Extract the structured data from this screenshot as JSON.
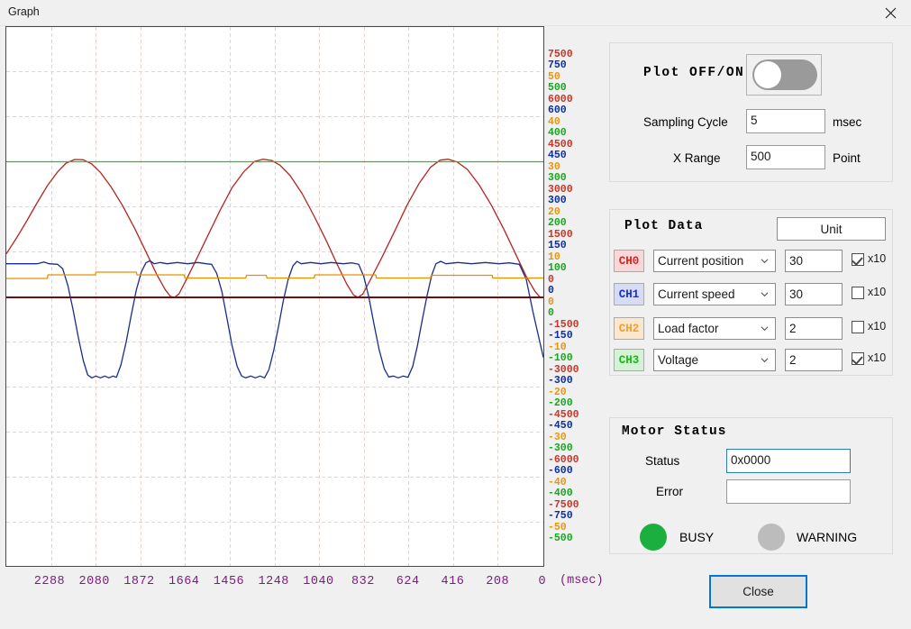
{
  "window": {
    "title": "Graph",
    "close_icon": "close-icon"
  },
  "chart_data": {
    "type": "line",
    "title": "",
    "xlabel": "(msec)",
    "ylabel": "",
    "grid": true,
    "legend_position": "none",
    "x_ticks": [
      2288,
      2080,
      1872,
      1664,
      1456,
      1248,
      1040,
      832,
      624,
      416,
      208,
      0
    ],
    "x_unit": "(msec)",
    "xlim": [
      2496,
      0
    ],
    "y_scales": [
      {
        "channel": "CH0",
        "name": "Current position",
        "color": "#c0392b",
        "ticks": [
          7500,
          6000,
          4500,
          3000,
          1500,
          0,
          -1500,
          -3000,
          -4500,
          -6000,
          -7500
        ]
      },
      {
        "channel": "CH1",
        "name": "Current speed",
        "color": "#0d2f9e",
        "ticks": [
          750,
          600,
          450,
          300,
          150,
          0,
          -150,
          -300,
          -450,
          -600,
          -750
        ]
      },
      {
        "channel": "CH2",
        "name": "Load factor",
        "color": "#e8960c",
        "ticks": [
          50,
          40,
          30,
          20,
          10,
          0,
          -10,
          -20,
          -30,
          -40,
          -50
        ]
      },
      {
        "channel": "CH3",
        "name": "Voltage",
        "color": "#16a81c",
        "ticks": [
          500,
          400,
          300,
          200,
          100,
          0,
          -100,
          -200,
          -300,
          -400,
          -500
        ]
      }
    ],
    "series": [
      {
        "name": "CH0 Current position",
        "color": "#b52521",
        "description": "Triangular/sine-like sweep, 3 cycles, peak ~4600, trough ~0",
        "points": [
          [
            0,
            1450
          ],
          [
            30,
            1980
          ],
          [
            60,
            2550
          ],
          [
            90,
            3150
          ],
          [
            120,
            3720
          ],
          [
            150,
            4180
          ],
          [
            175,
            4470
          ],
          [
            200,
            4590
          ],
          [
            225,
            4580
          ],
          [
            250,
            4440
          ],
          [
            275,
            4160
          ],
          [
            305,
            3700
          ],
          [
            340,
            3050
          ],
          [
            375,
            2300
          ],
          [
            410,
            1480
          ],
          [
            440,
            760
          ],
          [
            465,
            250
          ],
          [
            480,
            30
          ],
          [
            492,
            0
          ],
          [
            505,
            120
          ],
          [
            525,
            560
          ],
          [
            555,
            1250
          ],
          [
            590,
            2080
          ],
          [
            625,
            2900
          ],
          [
            660,
            3650
          ],
          [
            695,
            4190
          ],
          [
            725,
            4520
          ],
          [
            750,
            4600
          ],
          [
            775,
            4560
          ],
          [
            800,
            4400
          ],
          [
            830,
            4050
          ],
          [
            865,
            3450
          ],
          [
            900,
            2700
          ],
          [
            935,
            1900
          ],
          [
            968,
            1080
          ],
          [
            995,
            450
          ],
          [
            1015,
            80
          ],
          [
            1028,
            0
          ],
          [
            1042,
            110
          ],
          [
            1065,
            600
          ],
          [
            1098,
            1330
          ],
          [
            1135,
            2200
          ],
          [
            1172,
            3080
          ],
          [
            1208,
            3820
          ],
          [
            1240,
            4330
          ],
          [
            1268,
            4570
          ],
          [
            1292,
            4600
          ],
          [
            1318,
            4510
          ],
          [
            1348,
            4260
          ],
          [
            1382,
            3750
          ],
          [
            1418,
            3070
          ],
          [
            1455,
            2260
          ],
          [
            1490,
            1420
          ],
          [
            1520,
            700
          ],
          [
            1545,
            210
          ],
          [
            1560,
            10
          ],
          [
            1570,
            0
          ]
        ]
      },
      {
        "name": "CH1 Current speed",
        "color": "#1a2c8c",
        "description": "Trapezoidal speed profile alternating positive plateau ~110 and negative plateau ~-260",
        "points": [
          [
            0,
            112
          ],
          [
            90,
            112
          ],
          [
            110,
            118
          ],
          [
            125,
            112
          ],
          [
            150,
            110
          ],
          [
            165,
            95
          ],
          [
            180,
            40
          ],
          [
            195,
            -40
          ],
          [
            210,
            -130
          ],
          [
            225,
            -210
          ],
          [
            238,
            -258
          ],
          [
            250,
            -268
          ],
          [
            262,
            -262
          ],
          [
            275,
            -268
          ],
          [
            288,
            -262
          ],
          [
            300,
            -268
          ],
          [
            312,
            -262
          ],
          [
            322,
            -266
          ],
          [
            335,
            -225
          ],
          [
            350,
            -150
          ],
          [
            365,
            -60
          ],
          [
            380,
            25
          ],
          [
            395,
            85
          ],
          [
            408,
            115
          ],
          [
            420,
            122
          ],
          [
            432,
            112
          ],
          [
            450,
            116
          ],
          [
            470,
            112
          ],
          [
            500,
            116
          ],
          [
            530,
            112
          ],
          [
            560,
            116
          ],
          [
            585,
            112
          ],
          [
            600,
            110
          ],
          [
            615,
            80
          ],
          [
            630,
            20
          ],
          [
            645,
            -70
          ],
          [
            660,
            -160
          ],
          [
            675,
            -230
          ],
          [
            688,
            -262
          ],
          [
            700,
            -268
          ],
          [
            715,
            -262
          ],
          [
            728,
            -268
          ],
          [
            742,
            -262
          ],
          [
            755,
            -268
          ],
          [
            768,
            -240
          ],
          [
            782,
            -175
          ],
          [
            796,
            -95
          ],
          [
            810,
            -10
          ],
          [
            824,
            60
          ],
          [
            838,
            105
          ],
          [
            850,
            120
          ],
          [
            862,
            112
          ],
          [
            890,
            116
          ],
          [
            920,
            112
          ],
          [
            950,
            116
          ],
          [
            985,
            112
          ],
          [
            1010,
            115
          ],
          [
            1030,
            110
          ],
          [
            1045,
            70
          ],
          [
            1060,
            0
          ],
          [
            1075,
            -90
          ],
          [
            1090,
            -175
          ],
          [
            1105,
            -238
          ],
          [
            1118,
            -265
          ],
          [
            1132,
            -262
          ],
          [
            1146,
            -268
          ],
          [
            1160,
            -262
          ],
          [
            1174,
            -266
          ],
          [
            1188,
            -230
          ],
          [
            1202,
            -160
          ],
          [
            1216,
            -75
          ],
          [
            1230,
            5
          ],
          [
            1244,
            75
          ],
          [
            1256,
            112
          ],
          [
            1270,
            120
          ],
          [
            1285,
            112
          ],
          [
            1320,
            116
          ],
          [
            1360,
            112
          ],
          [
            1400,
            116
          ],
          [
            1440,
            112
          ],
          [
            1470,
            115
          ],
          [
            1500,
            110
          ],
          [
            1520,
            60
          ],
          [
            1540,
            -50
          ],
          [
            1560,
            -150
          ],
          [
            1570,
            -200
          ]
        ]
      },
      {
        "name": "CH2 Load factor",
        "color": "#e59000",
        "description": "Step-like load factor baseline ~4.2 with small steps up to ~5.0",
        "points": [
          [
            0,
            4.2
          ],
          [
            120,
            4.2
          ],
          [
            122,
            5.0
          ],
          [
            260,
            5.0
          ],
          [
            262,
            5.6
          ],
          [
            380,
            5.6
          ],
          [
            382,
            5.0
          ],
          [
            520,
            5.0
          ],
          [
            522,
            4.3
          ],
          [
            700,
            4.3
          ],
          [
            702,
            4.9
          ],
          [
            760,
            4.9
          ],
          [
            762,
            4.3
          ],
          [
            900,
            4.3
          ],
          [
            902,
            5.0
          ],
          [
            1080,
            5.0
          ],
          [
            1082,
            4.3
          ],
          [
            1240,
            4.3
          ],
          [
            1242,
            4.9
          ],
          [
            1420,
            4.9
          ],
          [
            1422,
            4.3
          ],
          [
            1570,
            4.3
          ]
        ]
      },
      {
        "name": "CH3 Voltage",
        "color": "#22c322",
        "description": "Nearly constant voltage line at ~301",
        "points": [
          [
            0,
            301
          ],
          [
            1570,
            301
          ]
        ]
      },
      {
        "name": "zero-line",
        "color": "#6b1111",
        "description": "Dark red horizontal zero axis",
        "points": [
          [
            0,
            0
          ],
          [
            1570,
            0
          ]
        ]
      }
    ]
  },
  "plot_control": {
    "onoff_label": "Plot OFF/ON",
    "toggle_state": "off",
    "sampling_label": "Sampling Cycle",
    "sampling_value": "5",
    "sampling_unit": "msec",
    "xrange_label": "X  Range",
    "xrange_value": "500",
    "xrange_unit": "Point"
  },
  "plot_data": {
    "title": "Plot Data",
    "unit_button": "Unit",
    "x10_label": "x10",
    "channels": [
      {
        "id": "CH0",
        "text_color": "#e02020",
        "bg_color": "#f7d7d7",
        "source": "Current position",
        "value": "30",
        "x10_checked": true
      },
      {
        "id": "CH1",
        "text_color": "#1a2fd0",
        "bg_color": "#d7dcf5",
        "source": "Current speed",
        "value": "30",
        "x10_checked": false
      },
      {
        "id": "CH2",
        "text_color": "#f0a030",
        "bg_color": "#fbe7cd",
        "source": "Load factor",
        "value": "2",
        "x10_checked": false
      },
      {
        "id": "CH3",
        "text_color": "#15bb15",
        "bg_color": "#d6f2d6",
        "source": "Voltage",
        "value": "2",
        "x10_checked": true
      }
    ]
  },
  "motor_status": {
    "title": "Motor Status",
    "status_label": "Status",
    "status_value": "0x0000",
    "error_label": "Error",
    "error_value": "",
    "busy_label": "BUSY",
    "busy_color": "#1aaf3f",
    "warning_label": "WARNING",
    "warning_color": "#bcbcbc"
  },
  "footer": {
    "close_label": "Close"
  }
}
